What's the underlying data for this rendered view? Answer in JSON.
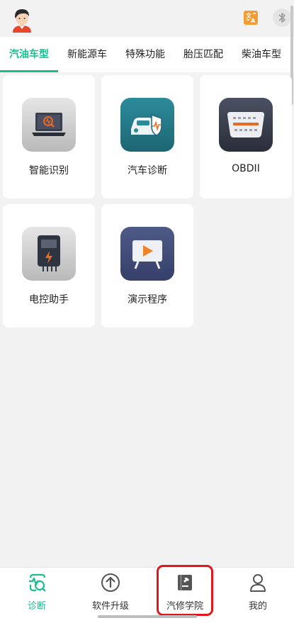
{
  "header": {
    "avatar_icon": "user-avatar-icon",
    "translate_icon": "translate-icon",
    "bluetooth_icon": "bluetooth-icon",
    "accent_color": "#f39c34"
  },
  "tabs": [
    {
      "label": "汽油车型",
      "active": true
    },
    {
      "label": "新能源车",
      "active": false
    },
    {
      "label": "特殊功能",
      "active": false
    },
    {
      "label": "胎压匹配",
      "active": false
    },
    {
      "label": "柴油车型",
      "active": false
    }
  ],
  "cards": [
    {
      "label": "智能识别",
      "icon": "laptop-diagnostic-icon"
    },
    {
      "label": "汽车诊断",
      "icon": "car-shield-icon"
    },
    {
      "label": "OBDII",
      "icon": "obd-connector-icon"
    },
    {
      "label": "电控助手",
      "icon": "ecu-lightning-icon"
    },
    {
      "label": "演示程序",
      "icon": "play-screen-icon"
    }
  ],
  "bottom_nav": [
    {
      "label": "诊断",
      "icon": "diagnosis-icon",
      "active": true
    },
    {
      "label": "软件升级",
      "icon": "upgrade-arrow-icon",
      "active": false
    },
    {
      "label": "汽修学院",
      "icon": "repair-book-icon",
      "active": false
    },
    {
      "label": "我的",
      "icon": "person-icon",
      "active": false
    }
  ],
  "colors": {
    "primary": "#1bbd90",
    "highlight": "#e3161d"
  }
}
